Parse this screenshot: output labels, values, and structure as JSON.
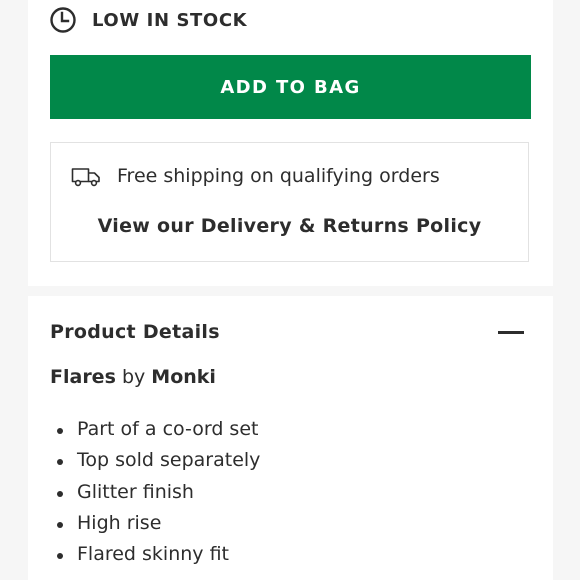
{
  "stock": {
    "icon": "clock-icon",
    "label": "LOW IN STOCK"
  },
  "cart": {
    "add_label": "ADD TO BAG",
    "button_color": "#018849"
  },
  "delivery": {
    "icon": "truck-icon",
    "shipping_text": "Free shipping on qualifying orders",
    "policy_link": "View our Delivery & Returns Policy"
  },
  "details": {
    "title": "Product Details",
    "toggle_icon": "minus-icon",
    "product_name": "Flares",
    "by_text": "by",
    "brand": "Monki",
    "features": [
      "Part of a co-ord set",
      "Top sold separately",
      "Glitter finish",
      "High rise",
      "Flared skinny fit"
    ]
  }
}
